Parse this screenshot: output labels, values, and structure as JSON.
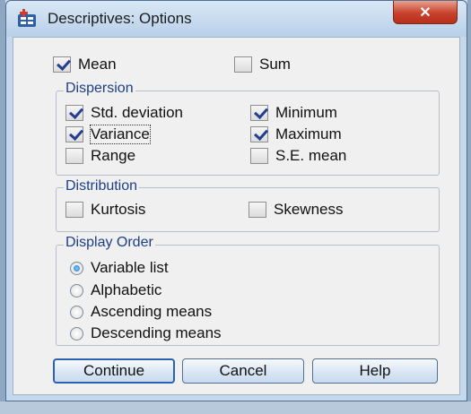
{
  "window": {
    "title": "Descriptives: Options",
    "close_glyph": "✕"
  },
  "checkboxes": {
    "mean": {
      "label": "Mean",
      "checked": true
    },
    "sum": {
      "label": "Sum",
      "checked": false
    }
  },
  "dispersion": {
    "title": "Dispersion",
    "items": [
      {
        "label": "Std. deviation",
        "checked": true
      },
      {
        "label": "Minimum",
        "checked": true
      },
      {
        "label": "Variance",
        "checked": true
      },
      {
        "label": "Maximum",
        "checked": true
      },
      {
        "label": "Range",
        "checked": false
      },
      {
        "label": "S.E. mean",
        "checked": false
      }
    ]
  },
  "distribution": {
    "title": "Distribution",
    "items": [
      {
        "label": "Kurtosis",
        "checked": false
      },
      {
        "label": "Skewness",
        "checked": false
      }
    ]
  },
  "display_order": {
    "title": "Display Order",
    "options": [
      {
        "label": "Variable list",
        "selected": true
      },
      {
        "label": "Alphabetic",
        "selected": false
      },
      {
        "label": "Ascending means",
        "selected": false
      },
      {
        "label": "Descending means",
        "selected": false
      }
    ]
  },
  "buttons": {
    "continue": "Continue",
    "cancel": "Cancel",
    "help": "Help"
  },
  "colors": {
    "group_title": "#1d3f86",
    "check": "#243f8f",
    "close": "#c7412c"
  },
  "icons": {
    "app": "spss-descriptives-icon",
    "close": "close-icon"
  }
}
